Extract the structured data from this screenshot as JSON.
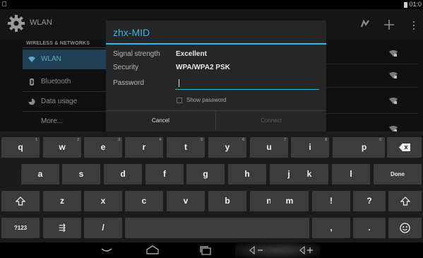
{
  "status_bar": {
    "time": "01:0"
  },
  "action_bar": {
    "title": "WLAN",
    "refresh_icon": "refresh-icon",
    "add_icon": "add-icon",
    "menu_icon": "overflow-menu-icon"
  },
  "sidebar": {
    "section_header": "WIRELESS & NETWORKS",
    "items": [
      {
        "label": "WLAN",
        "icon": "wifi-icon",
        "selected": true
      },
      {
        "label": "Bluetooth",
        "icon": "bluetooth-icon"
      },
      {
        "label": "Data usage",
        "icon": "data-usage-icon"
      },
      {
        "label": "More...",
        "icon": ""
      }
    ]
  },
  "dialog": {
    "title": "zhx-MID",
    "signal_label": "Signal strength",
    "signal_value": "Excellent",
    "security_label": "Security",
    "security_value": "WPA/WPA2 PSK",
    "password_label": "Password",
    "password_value": "",
    "show_password_label": "Show password",
    "show_password_checked": false,
    "cancel_label": "Cancel",
    "connect_label": "Connect",
    "connect_enabled": false
  },
  "keyboard": {
    "row1": [
      {
        "k": "q",
        "h": "1"
      },
      {
        "k": "w",
        "h": "2"
      },
      {
        "k": "e",
        "h": "3"
      },
      {
        "k": "r",
        "h": "4"
      },
      {
        "k": "t",
        "h": "5"
      },
      {
        "k": "y",
        "h": "6"
      },
      {
        "k": "u",
        "h": "7"
      },
      {
        "k": "i",
        "h": "8"
      },
      {
        "k": "o",
        "h": "9"
      },
      {
        "k": "p",
        "h": "0"
      }
    ],
    "row2": [
      "a",
      "s",
      "d",
      "f",
      "g",
      "h",
      "j",
      "k",
      "l"
    ],
    "row3": [
      "z",
      "x",
      "c",
      "v",
      "b",
      "n",
      "m",
      "!",
      "?"
    ],
    "done_label": "Done",
    "symbols_label": "?123",
    "settings_glyph": "⇶",
    "slash": "/",
    "comma": ",",
    "period": "."
  },
  "nav_bar": {
    "buttons": [
      "back-icon",
      "home-icon",
      "recents-icon",
      "volume-down-icon",
      "volume-up-icon"
    ]
  },
  "colors": {
    "accent": "#33b5e5",
    "selected_bg": "#1f3f52",
    "key_bg": "#3c3c3c"
  }
}
